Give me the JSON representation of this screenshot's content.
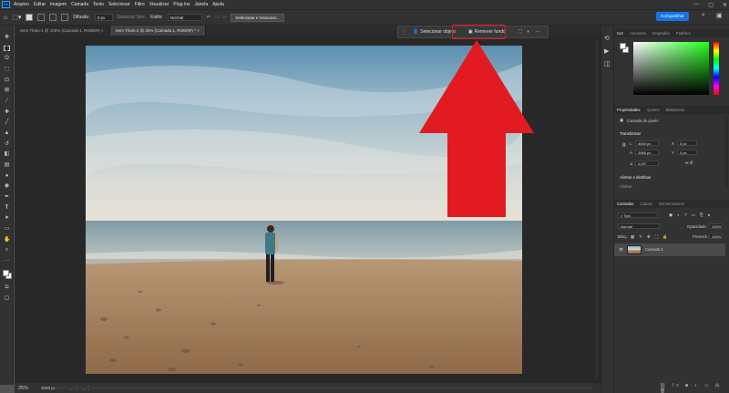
{
  "app": {
    "logo": "Ps",
    "menu": [
      "Arquivo",
      "Editar",
      "Imagem",
      "Camada",
      "Texto",
      "Selecionar",
      "Filtro",
      "Visualizar",
      "Plug-ins",
      "Janela",
      "Ajuda"
    ],
    "window_controls": [
      "—",
      "▢",
      "✕"
    ]
  },
  "options_bar": {
    "diffusion_label": "Difusão:",
    "diffusion_value": "0 px",
    "antialias_label": "Suavizar Serr.",
    "style_label": "Estilo:",
    "style_value": "Normal",
    "select_mask_button": "Selecionar e mascarar...",
    "share_button": "Compartilhar"
  },
  "tabs": [
    {
      "label": "Sem Título-1 @ 100% (Camada 1, RGB/8#) ×",
      "active": false
    },
    {
      "label": "Sem Título-2 @ 25% (Camada 1, RGB/8#) * ×",
      "active": true
    }
  ],
  "context_bar": {
    "select_subject": "Selecionar objeto",
    "remove_background": "Remover fundo",
    "more": "···"
  },
  "status_bar": {
    "zoom": "25%",
    "doc_info": "4000 px × 2000 px (72 ppi)"
  },
  "panels": {
    "color_tabs": [
      "Cor",
      "Amostras",
      "Degradês",
      "Padrões"
    ],
    "properties_tabs": [
      "Propriedades",
      "Ajustes",
      "Bibliotecas"
    ],
    "properties_layer_type": "Camada de pixels",
    "transform_title": "Transformar",
    "w_label": "L",
    "w_value": "4000 px",
    "h_label": "A",
    "h_value": "2666 px",
    "x_label": "X",
    "x_value": "0 px",
    "y_label": "Y",
    "y_value": "0 px",
    "angle_value": "0,00°",
    "align_title": "Alinhar e distribuir",
    "align_sub": "Alinhar:",
    "layers_tabs": [
      "Camadas",
      "Canais",
      "Demarcadores"
    ],
    "layers_kind": "Tipo",
    "blend_mode": "Normal",
    "opacity_label": "Opacidade:",
    "opacity_value": "100%",
    "lock_label": "Bloq.:",
    "fill_label": "Preench.:",
    "fill_value": "100%",
    "layer_name": "Camada 1"
  },
  "colors": {
    "accent": "#1473e6",
    "annotation_red": "#e21b22"
  }
}
